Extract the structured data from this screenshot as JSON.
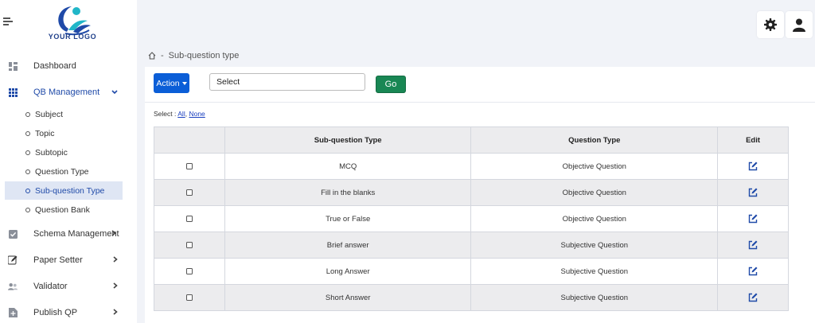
{
  "brand": {
    "logo_text": "YOUR LOGO"
  },
  "sidebar": {
    "items": [
      {
        "label": "Dashboard",
        "icon": "dashboard-icon"
      },
      {
        "label": "QB Management",
        "icon": "grid-icon",
        "expanded": true
      },
      {
        "label": "Schema Management",
        "icon": "checklist-icon"
      },
      {
        "label": "Paper Setter",
        "icon": "pen-icon"
      },
      {
        "label": "Validator",
        "icon": "users-icon"
      },
      {
        "label": "Publish QP",
        "icon": "publish-icon"
      }
    ],
    "sub_items": [
      {
        "label": "Subject"
      },
      {
        "label": "Topic"
      },
      {
        "label": "Subtopic"
      },
      {
        "label": "Question Type"
      },
      {
        "label": "Sub-question Type",
        "selected": true
      },
      {
        "label": "Question Bank"
      }
    ]
  },
  "header": {
    "settings_icon": "gear-icon",
    "profile_icon": "user-icon"
  },
  "breadcrumb": {
    "home_icon": "home-icon",
    "separator": "-",
    "current": "Sub-question type"
  },
  "toolbar": {
    "action_label": "Action",
    "select_value": "Select",
    "go_label": "Go"
  },
  "selection": {
    "prefix": "Select :",
    "all_label": "All",
    "comma": ",",
    "none_label": "None"
  },
  "table": {
    "headers": [
      "",
      "Sub-question Type",
      "Question Type",
      "Edit"
    ],
    "rows": [
      {
        "sub_type": "MCQ",
        "question_type": "Objective Question"
      },
      {
        "sub_type": "Fill in the blanks",
        "question_type": "Objective Question"
      },
      {
        "sub_type": "True or False",
        "question_type": "Objective Question"
      },
      {
        "sub_type": "Brief answer",
        "question_type": "Subjective Question"
      },
      {
        "sub_type": "Long Answer",
        "question_type": "Subjective Question"
      },
      {
        "sub_type": "Short Answer",
        "question_type": "Subjective Question"
      }
    ]
  },
  "colors": {
    "primary": "#0b5ed7",
    "success": "#198754",
    "active": "#1f4aa8",
    "background": "#f1f3f8"
  }
}
